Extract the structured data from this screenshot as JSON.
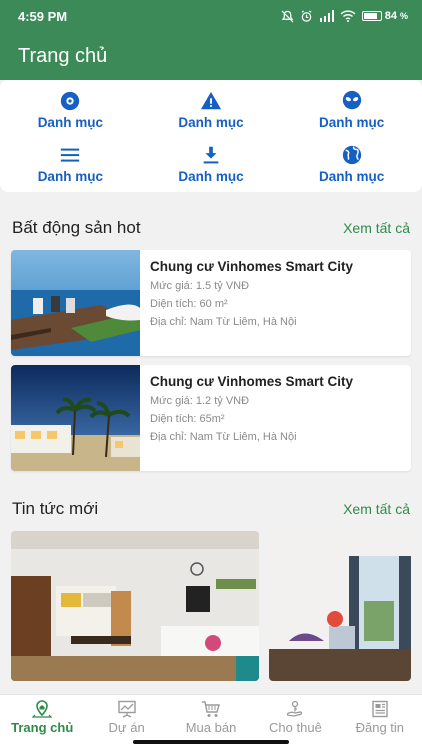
{
  "status_bar": {
    "time": "4:59 PM",
    "battery_pct": "84",
    "battery_level": 0.84
  },
  "app_bar": {
    "title": "Trang chủ"
  },
  "categories": [
    {
      "label": "Danh mục",
      "icon": "disc-icon"
    },
    {
      "label": "Danh mục",
      "icon": "warning-icon"
    },
    {
      "label": "Danh mục",
      "icon": "alien-icon"
    },
    {
      "label": "Danh mục",
      "icon": "menu-icon"
    },
    {
      "label": "Danh mục",
      "icon": "download-icon"
    },
    {
      "label": "Danh mục",
      "icon": "globe-icon"
    }
  ],
  "hot_section": {
    "title": "Bất động sản hot",
    "see_all": "Xem tất cả"
  },
  "properties": [
    {
      "title": "Chung cư Vinhomes Smart City",
      "price": "Mức giá: 1.5 tỷ VNĐ",
      "area": "Diện tích: 60 m²",
      "address": "Địa chỉ: Nam Từ Liêm, Hà Nội"
    },
    {
      "title": "Chung cư Vinhomes Smart City",
      "price": "Mức giá: 1.2 tỷ VNĐ",
      "area": "Diện tích: 65m²",
      "address": "Địa chỉ: Nam Từ Liêm, Hà Nội"
    }
  ],
  "news_section": {
    "title": "Tin tức mới",
    "see_all": "Xem tất cả"
  },
  "tabs": [
    {
      "label": "Trang chủ",
      "icon": "home-pin-icon",
      "active": true
    },
    {
      "label": "Dự án",
      "icon": "presentation-icon",
      "active": false
    },
    {
      "label": "Mua bán",
      "icon": "cart-icon",
      "active": false
    },
    {
      "label": "Cho thuê",
      "icon": "hand-key-icon",
      "active": false
    },
    {
      "label": "Đăng tin",
      "icon": "newspaper-icon",
      "active": false
    }
  ],
  "colors": {
    "primary": "#3b8a58",
    "link_blue": "#1560c2",
    "accent_green": "#2f8a4a"
  }
}
